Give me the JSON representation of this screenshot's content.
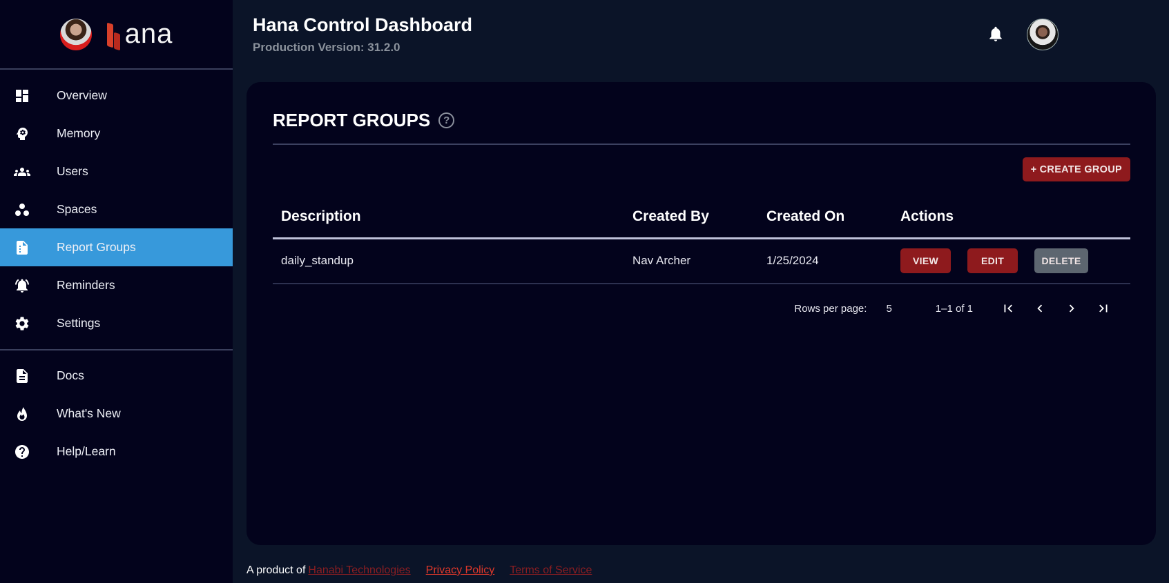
{
  "brand": {
    "logo_text": "ana"
  },
  "sidebar": {
    "items": [
      {
        "label": "Overview",
        "icon": "dashboard-icon",
        "active": false
      },
      {
        "label": "Memory",
        "icon": "brain-head-icon",
        "active": false
      },
      {
        "label": "Users",
        "icon": "users-group-icon",
        "active": false
      },
      {
        "label": "Spaces",
        "icon": "workspaces-icon",
        "active": false
      },
      {
        "label": "Report Groups",
        "icon": "report-file-icon",
        "active": true
      },
      {
        "label": "Reminders",
        "icon": "alarm-bell-icon",
        "active": false
      },
      {
        "label": "Settings",
        "icon": "gear-icon",
        "active": false
      }
    ],
    "secondary_items": [
      {
        "label": "Docs",
        "icon": "document-icon"
      },
      {
        "label": "What's New",
        "icon": "fire-icon"
      },
      {
        "label": "Help/Learn",
        "icon": "help-circle-icon"
      }
    ]
  },
  "header": {
    "title": "Hana Control Dashboard",
    "subtitle": "Production Version: 31.2.0",
    "notification_icon": "bell-icon",
    "avatar": "user-avatar"
  },
  "page": {
    "title": "REPORT GROUPS",
    "help_glyph": "?",
    "create_button": "+ CREATE GROUP",
    "table": {
      "columns": [
        "Description",
        "Created By",
        "Created On",
        "Actions"
      ],
      "rows": [
        {
          "description": "daily_standup",
          "created_by": "Nav Archer",
          "created_on": "1/25/2024",
          "actions": {
            "view": "VIEW",
            "edit": "EDIT",
            "delete": "DELETE"
          }
        }
      ]
    },
    "pagination": {
      "rows_per_page_label": "Rows per page:",
      "rows_per_page": "5",
      "range": "1–1 of 1"
    }
  },
  "footer": {
    "prefix": "A product of",
    "company_link": "Hanabi Technologies",
    "privacy_link": "Privacy Policy",
    "terms_link": "Terms of Service"
  },
  "colors": {
    "sidebar_bg": "#03031c",
    "page_bg": "#0b1428",
    "active_nav": "#3799db",
    "primary_button": "#8e1a1d",
    "delete_button": "#5d6670",
    "link_red": "#e0382a"
  }
}
